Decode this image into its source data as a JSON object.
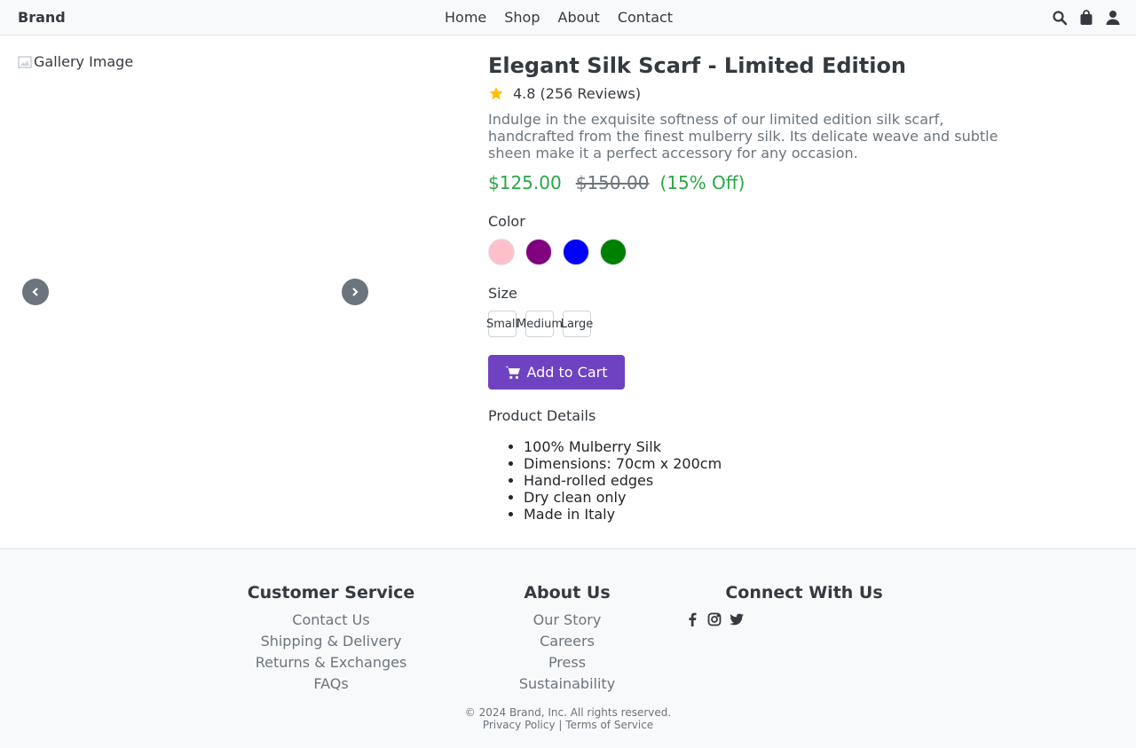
{
  "header": {
    "brand": "Brand",
    "nav": [
      "Home",
      "Shop",
      "About",
      "Contact"
    ],
    "icons": [
      "search-icon",
      "shopping-bag-icon",
      "user-icon"
    ]
  },
  "gallery": {
    "image_alt": "Gallery Image",
    "prev_icon": "chevron-left-icon",
    "next_icon": "chevron-right-icon"
  },
  "product": {
    "title": "Elegant Silk Scarf - Limited Edition",
    "rating": "4.8 (256 Reviews)",
    "description": "Indulge in the exquisite softness of our limited edition silk scarf, handcrafted from the finest mulberry silk. Its delicate weave and subtle sheen make it a perfect accessory for any occasion.",
    "price": "$125.00",
    "old_price": "$150.00",
    "discount": "(15% Off)",
    "color_label": "Color",
    "colors": [
      "#ffc0cb",
      "#800080",
      "#0000ff",
      "#008000"
    ],
    "size_label": "Size",
    "sizes": [
      "Small",
      "Medium",
      "Large"
    ],
    "add_to_cart": "Add to Cart",
    "details_title": "Product Details",
    "details": [
      "100% Mulberry Silk",
      "Dimensions: 70cm x 200cm",
      "Hand-rolled edges",
      "Dry clean only",
      "Made in Italy"
    ]
  },
  "footer": {
    "customer_service": {
      "title": "Customer Service",
      "links": [
        "Contact Us",
        "Shipping & Delivery",
        "Returns & Exchanges",
        "FAQs"
      ]
    },
    "about_us": {
      "title": "About Us",
      "links": [
        "Our Story",
        "Careers",
        "Press",
        "Sustainability"
      ]
    },
    "connect": {
      "title": "Connect With Us",
      "icons": [
        "facebook-icon",
        "instagram-icon",
        "twitter-icon"
      ]
    },
    "copyright": "© 2024 Brand, Inc. All rights reserved.",
    "privacy": "Privacy Policy",
    "separator": "|",
    "terms": "Terms of Service"
  }
}
